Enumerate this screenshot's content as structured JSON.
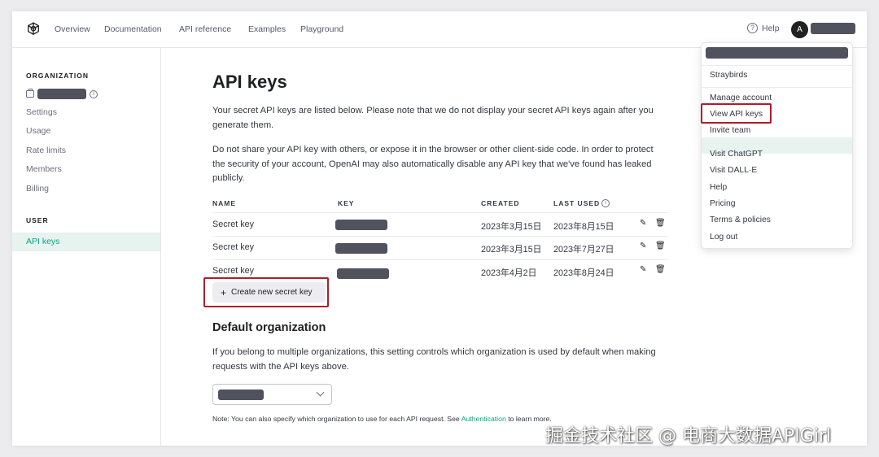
{
  "nav": {
    "links": [
      "Overview",
      "Documentation",
      "API reference",
      "Examples",
      "Playground"
    ],
    "help": "Help",
    "avatar_initial": "A"
  },
  "sidebar": {
    "org_heading": "ORGANIZATION",
    "items": [
      "Settings",
      "Usage",
      "Rate limits",
      "Members",
      "Billing"
    ],
    "user_heading": "USER",
    "active_item": "API keys"
  },
  "main": {
    "title": "API keys",
    "intro": "Your secret API keys are listed below. Please note that we do not display your secret API keys again after you generate them.",
    "warning": "Do not share your API key with others, or expose it in the browser or other client-side code. In order to protect the security of your account, OpenAI may also automatically disable any API key that we've found has leaked publicly.",
    "table": {
      "headers": {
        "name": "NAME",
        "key": "KEY",
        "created": "CREATED",
        "last_used": "LAST USED"
      },
      "rows": [
        {
          "name": "Secret key",
          "created": "2023年3月15日",
          "last_used": "2023年8月15日"
        },
        {
          "name": "Secret key",
          "created": "2023年3月15日",
          "last_used": "2023年7月27日"
        },
        {
          "name": "Secret key",
          "created": "2023年4月2日",
          "last_used": "2023年8月24日"
        }
      ]
    },
    "create_button": "Create new secret key",
    "default_org_title": "Default organization",
    "default_org_desc": "If you belong to multiple organizations, this setting controls which organization is used by default when making requests with the API keys above.",
    "note_prefix": "Note: You can also specify which organization to use for each API request. See",
    "note_link": "Authentication",
    "note_suffix": "to learn more."
  },
  "dropdown": {
    "org_name": "Straybirds",
    "items_group1": [
      "Manage account",
      "View API keys",
      "Invite team"
    ],
    "items_group2": [
      "Visit ChatGPT",
      "Visit DALL·E",
      "Help",
      "Pricing",
      "Terms & policies",
      "Log out"
    ]
  },
  "watermark": "掘金技术社区 @ 电商大数据APIGirl",
  "colors": {
    "accent": "#10a37f",
    "highlight_box": "#b01d2a",
    "redacted": "#50535e"
  }
}
